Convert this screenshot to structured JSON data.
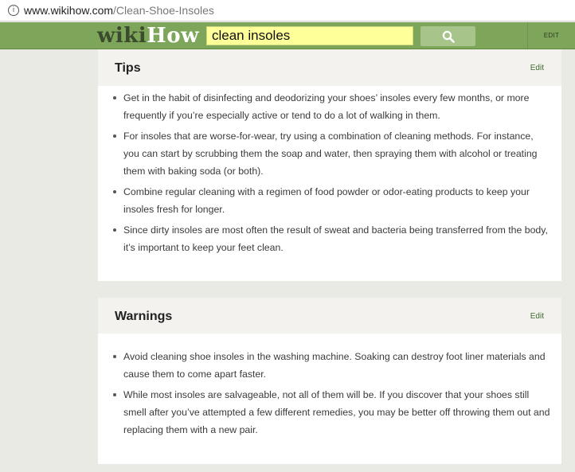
{
  "browser": {
    "url_domain": "www.wikihow.com",
    "url_path": "/Clean-Shoe-Insoles"
  },
  "header": {
    "logo_wiki": "wiki",
    "logo_how": "How",
    "search_value": "clean insoles",
    "edit_label": "EDIT"
  },
  "sections": {
    "tips": {
      "title": "Tips",
      "edit": "Edit",
      "items": [
        "Get in the habit of disinfecting and deodorizing your shoes’ insoles every few months, or more frequently if you’re especially active or tend to do a lot of walking in them.",
        "For insoles that are worse-for-wear, try using a combination of cleaning methods. For instance, you can start by scrubbing them the soap and water, then spraying them with alcohol or treating them with baking soda (or both).",
        "Combine regular cleaning with a regimen of food powder or odor-eating products to keep your insoles fresh for longer.",
        "Since dirty insoles are most often the result of sweat and bacteria being transferred from the body, it’s important to keep your feet clean."
      ]
    },
    "warnings": {
      "title": "Warnings",
      "edit": "Edit",
      "items": [
        "Avoid cleaning shoe insoles in the washing machine. Soaking can destroy foot liner materials and cause them to come apart faster.",
        "While most insoles are salvageable, not all of them will be. If you discover that your shoes still smell after you’ve attempted a few different remedies, you may be better off throwing them out and replacing them with a new pair."
      ]
    }
  },
  "icons": {
    "info": "info-icon",
    "search": "search-icon"
  },
  "colors": {
    "header_green": "#7ea65a",
    "search_bg": "#ffff99",
    "edit_green": "#3c6b2a"
  }
}
